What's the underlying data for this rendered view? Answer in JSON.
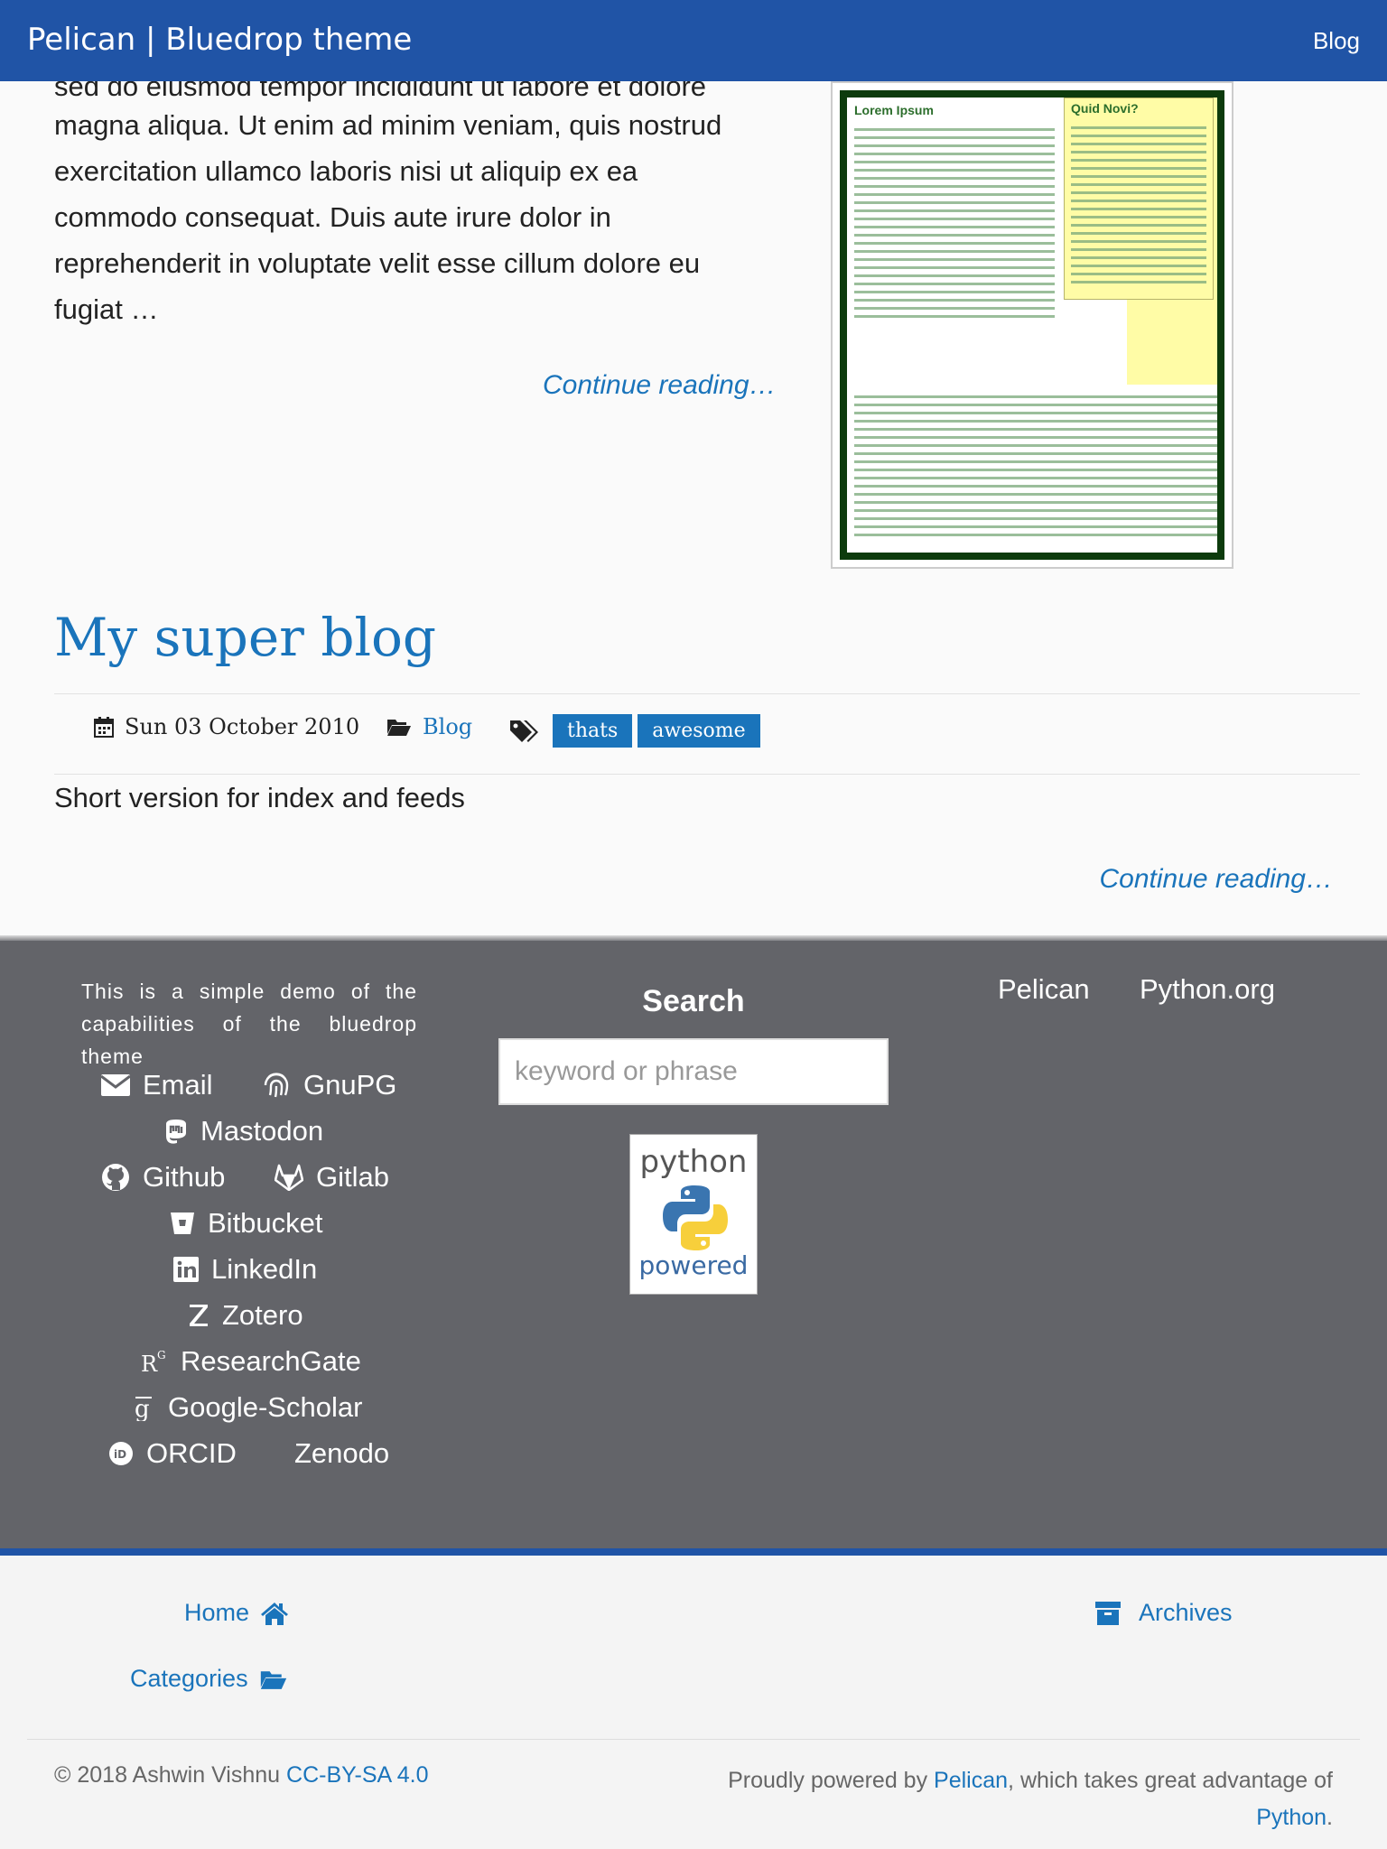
{
  "header": {
    "brand": "Pelican | Bluedrop theme",
    "nav_blog": "Blog"
  },
  "post1": {
    "cut_line": "sed do eiusmod tempor incididunt ut labore et dolore",
    "excerpt": "magna aliqua. Ut enim ad minim veniam, quis nostrud exercitation ullamco laboris nisi ut aliquip ex ea commodo consequat. Duis aute irure dolor in reprehenderit in voluptate velit esse cillum dolore eu fugiat …",
    "continue": "Continue reading…",
    "thumb_heading_left": "Lorem Ipsum",
    "thumb_heading_box": "Quid Novi?"
  },
  "post2": {
    "title": "My super blog",
    "date": "Sun 03 October 2010",
    "category": "Blog",
    "tags": [
      "thats",
      "awesome"
    ],
    "summary": "Short version for index and feeds",
    "continue": "Continue reading…"
  },
  "footer": {
    "about": "This is a simple demo of the capabilities of the bluedrop theme",
    "social": {
      "email": "Email",
      "gnupg": "GnuPG",
      "mastodon": "Mastodon",
      "github": "Github",
      "gitlab": "Gitlab",
      "bitbucket": "Bitbucket",
      "linkedin": "LinkedIn",
      "zotero": "Zotero",
      "researchgate": "ResearchGate",
      "googlescholar": "Google-Scholar",
      "orcid": "ORCID",
      "zenodo": "Zenodo"
    },
    "search_title": "Search",
    "search_placeholder": "keyword or phrase",
    "badge_top": "python",
    "badge_bottom": "powered",
    "link_pelican": "Pelican",
    "link_python": "Python.org"
  },
  "bottom": {
    "home": "Home",
    "archives": "Archives",
    "categories": "Categories",
    "copyright": "© 2018 Ashwin Vishnu",
    "license": "CC-BY-SA 4.0",
    "powered_prefix": "Proudly powered by",
    "powered_pelican": "Pelican",
    "powered_middle": ", which takes great advantage of",
    "powered_python": "Python",
    "powered_suffix": "."
  },
  "colors": {
    "brand_blue": "#2054a6",
    "link_blue": "#1a74bb",
    "footer_gray": "#636469"
  }
}
